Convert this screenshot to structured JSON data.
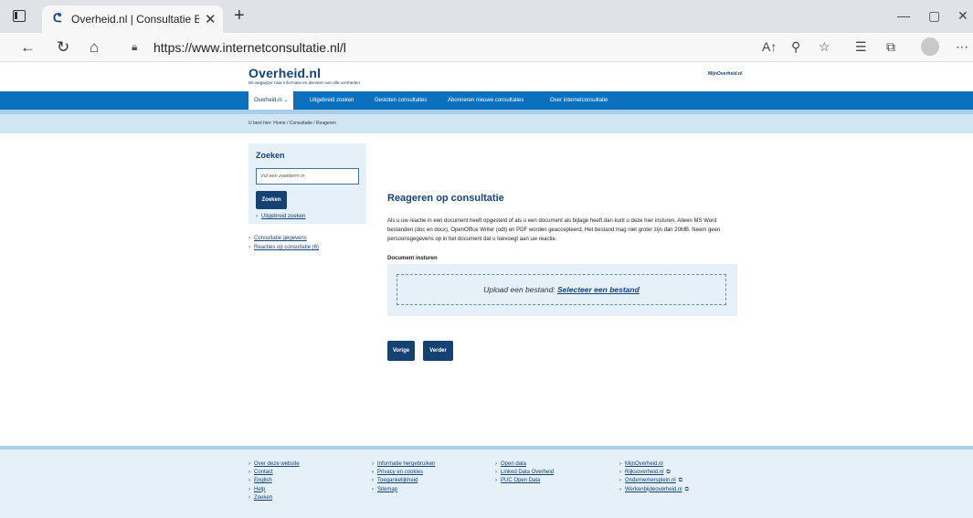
{
  "browser": {
    "tab_title": "Overheid.nl | Consultatie Elektronische",
    "url": "https://www.internetconsultatie.nl/l",
    "new_tab": "+",
    "close_tab": "✕"
  },
  "site": {
    "logo": "Overheid.nl",
    "tagline": "De wegwijzer naar informatie en diensten van alle overheden",
    "mijn_link": "MijnOverheid.nl"
  },
  "nav": {
    "items": [
      {
        "label": "Overheid.nl ⌄"
      },
      {
        "label": "Uitgebreid zoeken"
      },
      {
        "label": "Gesloten consultaties"
      },
      {
        "label": "Abonneren nieuwe consultaties"
      },
      {
        "label": "Over internetconsultatie"
      }
    ]
  },
  "breadcrumb": "U bent hier:  Home  /  Consultatie  /  Reageren",
  "sidebar": {
    "search_title": "Zoeken",
    "search_placeholder": "Vul een zoekterm in",
    "search_button": "Zoeken",
    "advanced_link": "Uitgebreid zoeken",
    "links": [
      {
        "label": "Consultatie gegevens"
      },
      {
        "label": "Reacties op consultatie (6)"
      }
    ]
  },
  "main": {
    "title": "Reageren op consultatie",
    "intro": "Als u uw reactie in een document heeft opgesteld of als u een document als bijlage heeft dan kunt u deze hier insturen. Alleen MS Word bestanden (doc en docx), OpenOffice Writer (odt) en PDF worden geaccepteerd. Het bestand mag niet groter zijn dan 20MB. Neem geen persoonsgegevens op in het document dat u toevoegt aan uw reactie.",
    "document_label": "Document insturen",
    "upload_prefix": "Upload een bestand: ",
    "upload_link": "Selecteer een bestand",
    "prev_button": "Vorige",
    "next_button": "Verder"
  },
  "footer": {
    "col1": [
      {
        "label": "Over deze website"
      },
      {
        "label": "Contact"
      },
      {
        "label": "English"
      },
      {
        "label": "Help"
      },
      {
        "label": "Zoeken"
      }
    ],
    "col2": [
      {
        "label": "Informatie hergebruiken"
      },
      {
        "label": "Privacy en cookies"
      },
      {
        "label": "Toegankelijkheid"
      },
      {
        "label": "Sitemap"
      }
    ],
    "col3": [
      {
        "label": "Open data"
      },
      {
        "label": "Linked Data Overheid"
      },
      {
        "label": "PUC Open Data"
      }
    ],
    "col4": [
      {
        "label": "MijnOverheid.nl"
      },
      {
        "label": "Rijksoverheid.nl"
      },
      {
        "label": "Ondernemersplein.nl"
      },
      {
        "label": "Werkenbijdeoverheid.nl"
      }
    ]
  },
  "colors": {
    "brand_dark": "#154273",
    "nav_blue": "#0b71bf",
    "light_blue": "#e5f0f9",
    "crumb_blue": "#d1e6f3"
  }
}
